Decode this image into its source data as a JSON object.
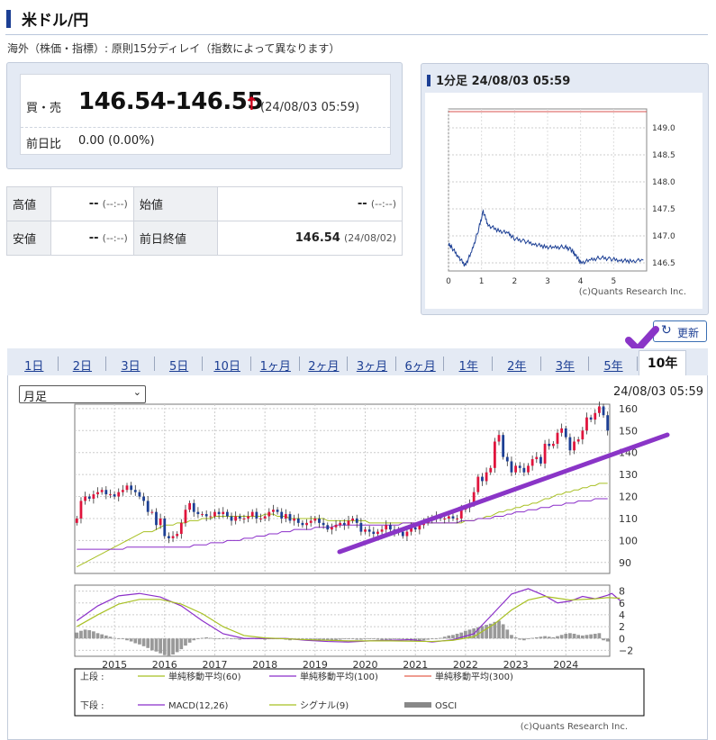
{
  "page": {
    "title": "米ドル/円",
    "note": "海外（株価・指標）: 原則15分ディレイ（指数によって異なります）"
  },
  "quote": {
    "bid_ask_label": "買・売",
    "price": "146.54-146.55",
    "arrow": "↑",
    "time": "(24/08/03 05:59)",
    "change_label": "前日比",
    "change": "0.00 (0.00%)"
  },
  "ohlc": {
    "high_label": "高値",
    "high_value": "--",
    "high_time": "(--:--)",
    "open_label": "始値",
    "open_value": "--",
    "open_time": "(--:--)",
    "low_label": "安値",
    "low_value": "--",
    "low_time": "(--:--)",
    "prev_close_label": "前日終値",
    "prev_close_value": "146.54",
    "prev_close_date": "(24/08/02)"
  },
  "mini_chart": {
    "title": "1分足 24/08/03 05:59",
    "credit": "(c)Quants Research Inc.",
    "y_ticks": [
      "149.0",
      "148.5",
      "148.0",
      "147.5",
      "147.0",
      "146.5"
    ],
    "x_ticks": [
      "0",
      "1",
      "2",
      "3",
      "4",
      "5"
    ],
    "reference_line": 149.3,
    "series_points": [
      [
        0.0,
        146.85
      ],
      [
        0.1,
        146.78
      ],
      [
        0.3,
        146.62
      ],
      [
        0.5,
        146.45
      ],
      [
        0.7,
        146.7
      ],
      [
        0.9,
        147.1
      ],
      [
        1.05,
        147.45
      ],
      [
        1.2,
        147.2
      ],
      [
        1.5,
        147.1
      ],
      [
        1.8,
        147.05
      ],
      [
        2.0,
        146.95
      ],
      [
        2.3,
        146.9
      ],
      [
        2.6,
        146.85
      ],
      [
        2.9,
        146.8
      ],
      [
        3.2,
        146.78
      ],
      [
        3.5,
        146.8
      ],
      [
        3.7,
        146.75
      ],
      [
        3.85,
        146.65
      ],
      [
        4.0,
        146.5
      ],
      [
        4.3,
        146.55
      ],
      [
        4.6,
        146.6
      ],
      [
        4.9,
        146.57
      ],
      [
        5.2,
        146.55
      ],
      [
        5.5,
        146.53
      ],
      [
        5.9,
        146.55
      ]
    ]
  },
  "refresh_label": "更新",
  "tabs": [
    {
      "label": "1日"
    },
    {
      "label": "2日"
    },
    {
      "label": "3日"
    },
    {
      "label": "5日"
    },
    {
      "label": "10日"
    },
    {
      "label": "1ヶ月"
    },
    {
      "label": "2ヶ月"
    },
    {
      "label": "3ヶ月"
    },
    {
      "label": "6ヶ月"
    },
    {
      "label": "1年"
    },
    {
      "label": "2年"
    },
    {
      "label": "3年"
    },
    {
      "label": "5年"
    },
    {
      "label": "10年",
      "active": true
    }
  ],
  "period_select": "月足",
  "chart_time": "24/08/03 05:59",
  "chart_data": {
    "type": "candlestick",
    "x_labels": [
      "2015",
      "2016",
      "2017",
      "2018",
      "2019",
      "2020",
      "2021",
      "2022",
      "2023",
      "2024"
    ],
    "upper_y_ticks": [
      "160",
      "150",
      "140",
      "130",
      "120",
      "110",
      "100",
      "90"
    ],
    "upper_ylim": [
      85,
      162
    ],
    "lower_y_ticks": [
      "8",
      "6",
      "4",
      "2",
      "0",
      "−2"
    ],
    "lower_ylim": [
      -3,
      9
    ],
    "closes": [
      110,
      118,
      120,
      119,
      121,
      122,
      123,
      121,
      121,
      120,
      122,
      123,
      125,
      123,
      122,
      120,
      118,
      113,
      113,
      107,
      110,
      102,
      101,
      102,
      103,
      108,
      114,
      117,
      113,
      112,
      112,
      111,
      111,
      113,
      112,
      113,
      111,
      109,
      111,
      110,
      110,
      111,
      113,
      110,
      110,
      111,
      113,
      114,
      113,
      110,
      112,
      109,
      110,
      108,
      107,
      108,
      109,
      110,
      108,
      107,
      105,
      106,
      107,
      108,
      107,
      109,
      110,
      108,
      104,
      105,
      104,
      103,
      104,
      105,
      107,
      105,
      104,
      104,
      102,
      104,
      106,
      105,
      107,
      108,
      110,
      110,
      111,
      110,
      110,
      111,
      110,
      110,
      114,
      115,
      117,
      122,
      129,
      127,
      131,
      133,
      145,
      148,
      138,
      136,
      131,
      134,
      133,
      131,
      134,
      137,
      138,
      135,
      144,
      143,
      144,
      149,
      151,
      147,
      141,
      145,
      146,
      150,
      156,
      155,
      158,
      161,
      157,
      150
    ],
    "sma60": [
      88,
      89,
      90,
      91,
      92,
      93,
      94,
      95,
      96,
      97,
      98,
      99,
      100,
      101,
      102,
      103,
      104,
      104,
      104,
      105,
      106,
      107,
      107,
      107,
      108,
      108,
      108,
      109,
      109,
      109,
      110,
      110,
      110,
      111,
      111,
      111,
      111,
      111,
      111,
      111,
      111,
      111,
      111,
      111,
      111,
      112,
      112,
      112,
      111,
      111,
      111,
      110,
      110,
      110,
      110,
      110,
      110,
      110,
      110,
      110,
      109,
      109,
      109,
      109,
      109,
      109,
      109,
      109,
      109,
      109,
      108,
      108,
      108,
      108,
      108,
      108,
      108,
      108,
      108,
      108,
      108,
      108,
      108,
      108,
      108,
      108,
      108,
      108,
      108,
      108,
      108,
      108,
      108,
      109,
      109,
      109,
      110,
      110,
      111,
      111,
      112,
      113,
      113,
      114,
      114,
      115,
      115,
      116,
      116,
      117,
      117,
      118,
      119,
      119,
      120,
      121,
      121,
      122,
      122,
      123,
      123,
      124,
      124,
      125,
      125,
      126,
      126,
      126
    ],
    "sma100": [
      96,
      96,
      96,
      96,
      96,
      96,
      96,
      96,
      96,
      96,
      96,
      96,
      97,
      97,
      97,
      97,
      97,
      97,
      97,
      97,
      97,
      97,
      97,
      97,
      97,
      97,
      97,
      97,
      98,
      98,
      98,
      98,
      99,
      99,
      99,
      99,
      100,
      100,
      100,
      100,
      101,
      101,
      101,
      102,
      102,
      102,
      103,
      103,
      103,
      104,
      104,
      104,
      105,
      105,
      105,
      105,
      105,
      106,
      106,
      106,
      106,
      106,
      107,
      107,
      107,
      107,
      107,
      107,
      107,
      107,
      107,
      107,
      107,
      107,
      107,
      107,
      107,
      107,
      108,
      108,
      108,
      108,
      108,
      108,
      108,
      108,
      108,
      108,
      108,
      108,
      108,
      108,
      109,
      109,
      109,
      109,
      110,
      110,
      110,
      110,
      111,
      111,
      111,
      112,
      112,
      113,
      113,
      113,
      114,
      114,
      114,
      115,
      115,
      115,
      116,
      116,
      116,
      117,
      117,
      117,
      118,
      118,
      118,
      118,
      119,
      119,
      119,
      119
    ],
    "macd_pts": [
      [
        0,
        3.0
      ],
      [
        5,
        5.5
      ],
      [
        10,
        7.2
      ],
      [
        15,
        7.6
      ],
      [
        20,
        7.0
      ],
      [
        25,
        5.5
      ],
      [
        30,
        3.0
      ],
      [
        35,
        0.8
      ],
      [
        40,
        0.0
      ],
      [
        50,
        0.0
      ],
      [
        55,
        -0.3
      ],
      [
        60,
        -0.5
      ],
      [
        65,
        -0.6
      ],
      [
        70,
        -0.4
      ],
      [
        75,
        -0.3
      ],
      [
        80,
        -0.2
      ],
      [
        85,
        -0.6
      ],
      [
        90,
        -0.2
      ],
      [
        95,
        0.8
      ],
      [
        100,
        4.5
      ],
      [
        104,
        7.5
      ],
      [
        108,
        8.4
      ],
      [
        112,
        7.2
      ],
      [
        115,
        6.0
      ],
      [
        118,
        6.3
      ],
      [
        121,
        7.1
      ],
      [
        124,
        6.7
      ],
      [
        127,
        7.3
      ],
      [
        128,
        7.6
      ],
      [
        130,
        6.4
      ]
    ],
    "signal_pts": [
      [
        0,
        2.0
      ],
      [
        5,
        4.0
      ],
      [
        10,
        5.8
      ],
      [
        15,
        6.6
      ],
      [
        20,
        6.6
      ],
      [
        25,
        5.8
      ],
      [
        30,
        4.2
      ],
      [
        35,
        2.0
      ],
      [
        40,
        0.5
      ],
      [
        45,
        0.1
      ],
      [
        55,
        -0.2
      ],
      [
        65,
        -0.4
      ],
      [
        75,
        -0.4
      ],
      [
        85,
        -0.5
      ],
      [
        90,
        -0.3
      ],
      [
        95,
        0.3
      ],
      [
        100,
        2.5
      ],
      [
        104,
        4.8
      ],
      [
        108,
        6.5
      ],
      [
        112,
        7.1
      ],
      [
        115,
        6.8
      ],
      [
        118,
        6.5
      ],
      [
        121,
        6.6
      ],
      [
        124,
        6.7
      ],
      [
        127,
        6.9
      ],
      [
        130,
        6.8
      ]
    ],
    "osci": [
      1.0,
      1.3,
      1.5,
      1.4,
      1.2,
      0.9,
      0.7,
      0.5,
      0.3,
      0.1,
      0.0,
      -0.1,
      -0.3,
      -0.5,
      -0.8,
      -1.0,
      -1.3,
      -1.6,
      -2.0,
      -2.2,
      -2.5,
      -2.8,
      -3.0,
      -2.7,
      -2.3,
      -1.8,
      -1.2,
      -0.7,
      -0.3,
      -0.1,
      0.1,
      0.2,
      0.1,
      0.0,
      -0.1,
      0.0,
      0.1,
      0.0,
      -0.1,
      -0.2,
      -0.1,
      0.0,
      0.1,
      0.0,
      -0.1,
      -0.2,
      -0.1,
      0.0,
      0.0,
      -0.1,
      -0.2,
      -0.3,
      -0.2,
      -0.1,
      0.0,
      -0.1,
      -0.2,
      -0.3,
      -0.2,
      -0.2,
      -0.3,
      -0.4,
      -0.3,
      -0.2,
      -0.1,
      0.0,
      -0.1,
      -0.2,
      -0.2,
      -0.1,
      0.0,
      -0.1,
      -0.2,
      -0.3,
      -0.3,
      -0.2,
      -0.1,
      0.0,
      -0.1,
      -0.3,
      -0.4,
      -0.5,
      -0.4,
      -0.3,
      -0.2,
      -0.1,
      0.0,
      0.1,
      0.3,
      0.5,
      0.6,
      0.8,
      1.0,
      1.3,
      1.5,
      1.7,
      1.9,
      2.1,
      2.3,
      2.5,
      2.8,
      3.0,
      2.4,
      1.5,
      0.6,
      0.2,
      -0.2,
      -0.3,
      -0.1,
      0.1,
      0.2,
      0.3,
      0.4,
      0.3,
      0.2,
      0.4,
      0.6,
      0.8,
      0.9,
      0.8,
      0.6,
      0.5,
      0.6,
      0.7,
      0.8,
      0.9,
      -0.3,
      -0.5
    ],
    "legend": [
      {
        "text": "上段 :",
        "color": ""
      },
      {
        "text": "単純移動平均(60)",
        "color": "#a8c023"
      },
      {
        "text": "単純移動平均(100)",
        "color": "#8b2fc9"
      },
      {
        "text": "単純移動平均(300)",
        "color": "#e5604e"
      },
      {
        "text": "下段 :",
        "color": ""
      },
      {
        "text": "MACD(12,26)",
        "color": "#8b2fc9"
      },
      {
        "text": "シグナル(9)",
        "color": "#a8c023"
      },
      {
        "text": "OSCI",
        "color": "#888888"
      }
    ],
    "credit": "(c)Quants Research Inc."
  },
  "colors": {
    "up": "#e0143c",
    "down": "#1c3f94",
    "annotation": "#8a35c7",
    "accent": "#1c3f94"
  }
}
